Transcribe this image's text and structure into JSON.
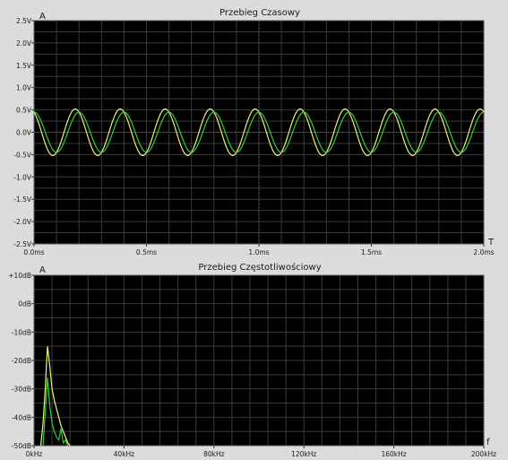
{
  "colors": {
    "background": "#dcdcdc",
    "plot_bg": "#000000",
    "grid": "#3a3a3a",
    "trace_a": "#f0f07a",
    "trace_b": "#2fcf3f"
  },
  "chart_data": [
    {
      "type": "line",
      "title": "Przebieg Czasowy",
      "y_axis_symbol": "A",
      "x_axis_symbol": "T",
      "x_ticks": [
        "0.0ms",
        "0.5ms",
        "1.0ms",
        "1.5ms",
        "2.0ms"
      ],
      "y_ticks": [
        "2.5V",
        "2.0V",
        "1.5V",
        "1.0V",
        "0.5V",
        "0.0V",
        "-0.5V",
        "-1.0V",
        "-1.5V",
        "-2.0V",
        "-2.5V"
      ],
      "xlim": [
        0,
        2.0
      ],
      "ylim": [
        -2.5,
        2.5
      ],
      "grid": true,
      "series": [
        {
          "amplitude": 0.52,
          "frequency_khz": 5.0,
          "phase_deg": 30,
          "color": "#f0f07a"
        },
        {
          "amplitude": 0.45,
          "frequency_khz": 5.0,
          "phase_deg": 0,
          "color": "#2fcf3f"
        }
      ]
    },
    {
      "type": "line",
      "title": "Przebieg Częstotliwościowy",
      "y_axis_symbol": "A",
      "x_axis_symbol": "f",
      "x_ticks": [
        "0kHz",
        "40kHz",
        "80kHz",
        "120kHz",
        "160kHz",
        "200kHz"
      ],
      "y_ticks": [
        "+10dB",
        "0dB",
        "-10dB",
        "-20dB",
        "-30dB",
        "-40dB",
        "-50dB"
      ],
      "xlim": [
        0,
        200
      ],
      "ylim": [
        -50,
        10
      ],
      "grid": true,
      "series": [
        {
          "color": "#f0f07a",
          "x": [
            3,
            4,
            5,
            5.5,
            6,
            7,
            8,
            9,
            10,
            11,
            12,
            13,
            14,
            15,
            16
          ],
          "y": [
            -50,
            -42,
            -30,
            -22,
            -15,
            -22,
            -30,
            -34,
            -37,
            -40,
            -43,
            -45,
            -47,
            -49,
            -50
          ]
        },
        {
          "color": "#2fcf3f",
          "x": [
            4,
            5,
            6,
            7,
            8,
            9,
            10,
            11,
            12,
            13,
            14,
            15
          ],
          "y": [
            -50,
            -38,
            -26,
            -36,
            -42,
            -45,
            -47,
            -48,
            -44,
            -49,
            -48,
            -50
          ]
        }
      ]
    }
  ]
}
